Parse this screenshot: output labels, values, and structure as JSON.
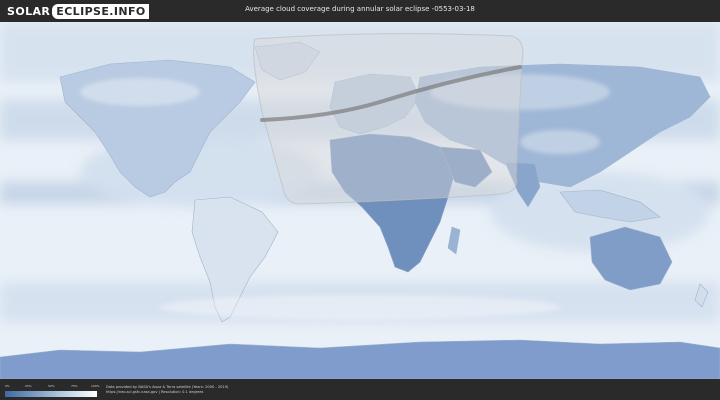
{
  "header": {
    "logo_part1": "SOLAR",
    "logo_part2": "ECLIPSE.INFO",
    "title": "Average cloud coverage during annular solar eclipse -0553-03-18"
  },
  "legend": {
    "ticks": [
      "0%",
      "25%",
      "50%",
      "75%",
      "100%"
    ],
    "colors": [
      "#3f6aa1",
      "#7f9fc6",
      "#c6d6ea",
      "#ffffff"
    ]
  },
  "credits": {
    "line1": "Data provided by NASA's Aqua & Terra satellite (Years: 2000 - 2019)",
    "line2": "https://neo.sci.gsfc.nasa.gov | Resolution: 0.1 degrees"
  },
  "map": {
    "background_color": "#e9f0f7",
    "cloud_color": "#5f82b3",
    "visibility_zone_color": "#d9d9d9",
    "path_color": "#7a7a7a"
  }
}
